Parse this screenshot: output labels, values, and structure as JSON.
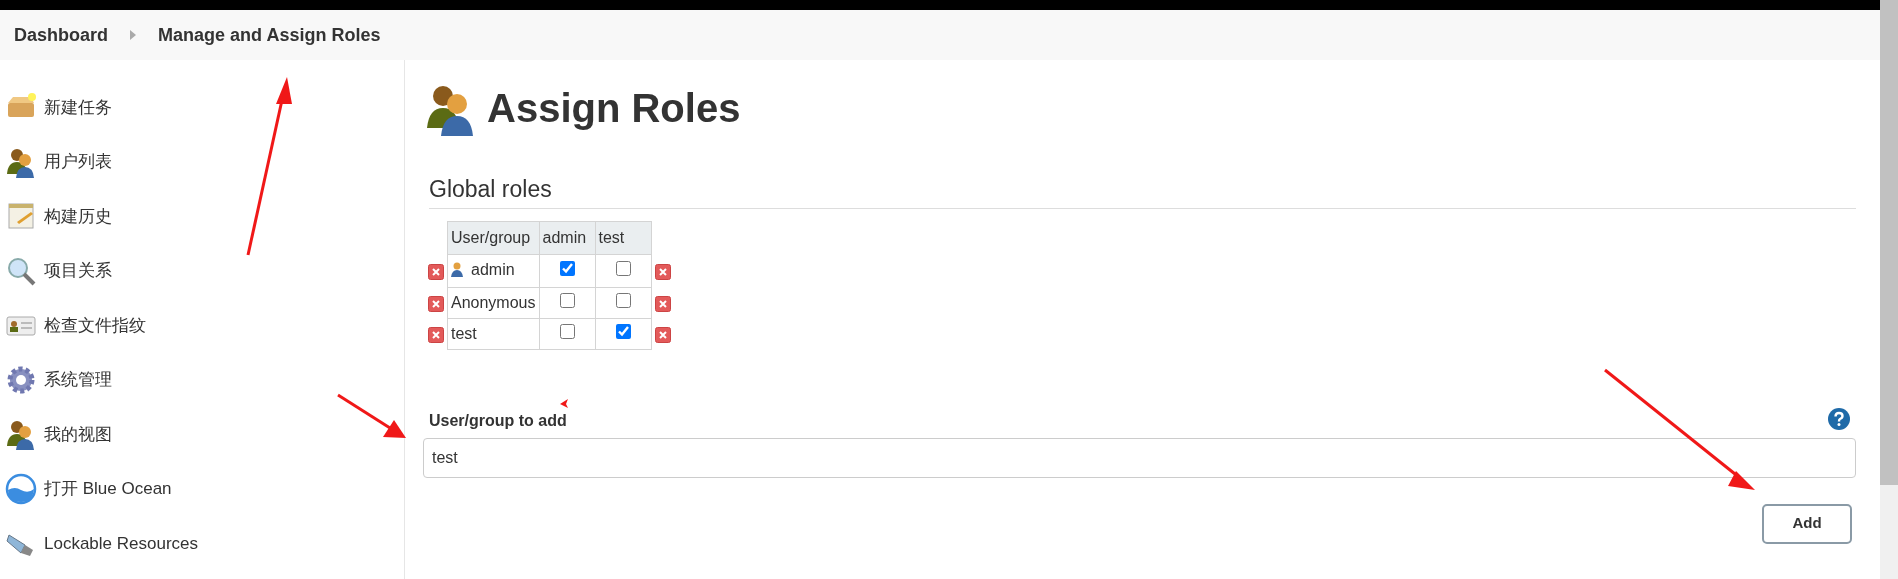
{
  "breadcrumbs": [
    {
      "label": "Dashboard"
    },
    {
      "label": "Manage and Assign Roles"
    }
  ],
  "sidebar": {
    "items": [
      {
        "label": "新建任务",
        "kind": "package"
      },
      {
        "label": "用户列表",
        "kind": "users"
      },
      {
        "label": "构建历史",
        "kind": "notepad"
      },
      {
        "label": "项目关系",
        "kind": "search"
      },
      {
        "label": "检查文件指纹",
        "kind": "card"
      },
      {
        "label": "系统管理",
        "kind": "gear"
      },
      {
        "label": "我的视图",
        "kind": "users"
      },
      {
        "label": "打开 Blue Ocean",
        "kind": "ocean"
      },
      {
        "label": "Lockable Resources",
        "kind": "usb"
      }
    ]
  },
  "page_title": "Assign Roles",
  "section_title": "Global roles",
  "table": {
    "columns": [
      "User/group",
      "admin",
      "test"
    ],
    "rows": [
      {
        "name": "admin",
        "kind": "user",
        "roles": [
          {
            "checked": true
          },
          {
            "checked": false
          }
        ]
      },
      {
        "name": "Anonymous",
        "kind": "plain",
        "roles": [
          {
            "checked": false
          },
          {
            "checked": false
          }
        ]
      },
      {
        "name": "test",
        "kind": "plain",
        "roles": [
          {
            "checked": false
          },
          {
            "checked": true
          }
        ]
      }
    ]
  },
  "add_form": {
    "label": "User/group to add",
    "value": "test",
    "button": "Add"
  }
}
